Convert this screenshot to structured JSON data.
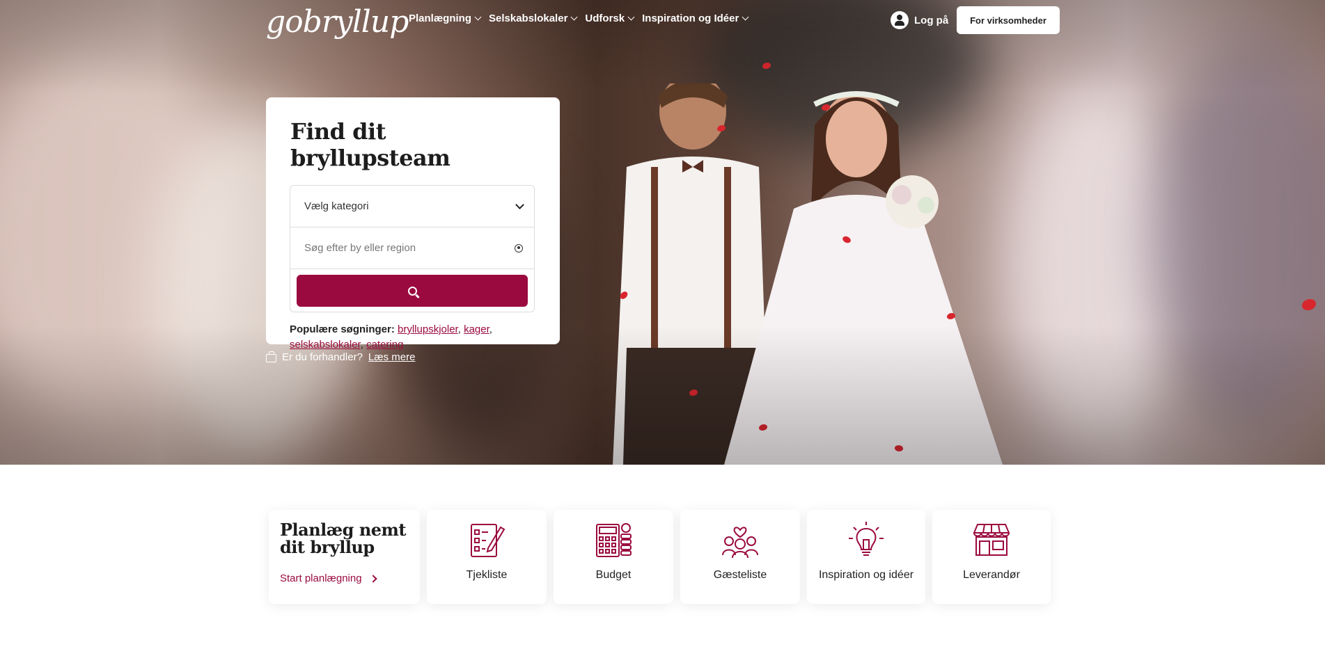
{
  "brand": {
    "logo_text": "gobryllup",
    "accent": "#9a0a3e"
  },
  "nav": {
    "items": [
      {
        "label": "Planlægning"
      },
      {
        "label": "Selskabslokaler"
      },
      {
        "label": "Udforsk"
      },
      {
        "label": "Inspiration og Idéer"
      }
    ],
    "login_label": "Log på",
    "business_button": "For virksomheder"
  },
  "search": {
    "title": "Find dit bryllupsteam",
    "category_placeholder": "Vælg kategori",
    "location_placeholder": "Søg efter by eller region",
    "popular_label": "Populære søgninger:",
    "popular_links": [
      "bryllupskjoler",
      "kager",
      "selskabslokaler",
      "catering"
    ]
  },
  "dealer": {
    "question": "Er du forhandler?",
    "link": "Læs mere"
  },
  "planning": {
    "title_line1": "Planlæg nemt",
    "title_line2": "dit bryllup",
    "start_link": "Start planlægning",
    "tools": [
      {
        "label": "Tjekliste",
        "icon": "checklist-icon"
      },
      {
        "label": "Budget",
        "icon": "calculator-icon"
      },
      {
        "label": "Gæsteliste",
        "icon": "guests-icon"
      },
      {
        "label": "Inspiration og idéer",
        "icon": "lightbulb-icon"
      },
      {
        "label": "Leverandør",
        "icon": "store-icon"
      }
    ]
  }
}
